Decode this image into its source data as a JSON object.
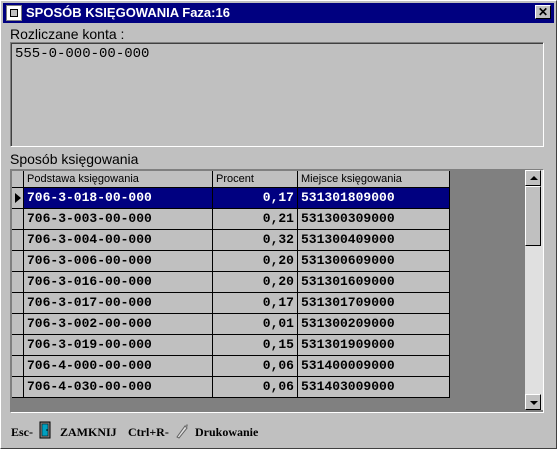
{
  "window": {
    "title": "SPOSÓB KSIĘGOWANIA Faza:16",
    "close_label": "✕"
  },
  "accounts": {
    "label": "Rozliczane konta :",
    "value": "555-0-000-00-000"
  },
  "grid": {
    "label": "Sposób księgowania",
    "columns": [
      "Podstawa księgowania",
      "Procent",
      "Miejsce księgowania"
    ],
    "rows": [
      [
        "706-3-018-00-000",
        "0,17",
        "531301809000"
      ],
      [
        "706-3-003-00-000",
        "0,21",
        "531300309000"
      ],
      [
        "706-3-004-00-000",
        "0,32",
        "531300409000"
      ],
      [
        "706-3-006-00-000",
        "0,20",
        "531300609000"
      ],
      [
        "706-3-016-00-000",
        "0,20",
        "531301609000"
      ],
      [
        "706-3-017-00-000",
        "0,17",
        "531301709000"
      ],
      [
        "706-3-002-00-000",
        "0,01",
        "531300209000"
      ],
      [
        "706-3-019-00-000",
        "0,15",
        "531301909000"
      ],
      [
        "706-4-000-00-000",
        "0,06",
        "531400009000"
      ],
      [
        "706-4-030-00-000",
        "0,06",
        "531403009000"
      ]
    ],
    "selected_row": 0
  },
  "footer": {
    "close_key": "Esc-",
    "close_label": "ZAMKNIJ",
    "print_key": "Ctrl+R-",
    "print_label": "Drukowanie"
  },
  "colors": {
    "selection": "#000080",
    "face": "#c0c0c0"
  }
}
